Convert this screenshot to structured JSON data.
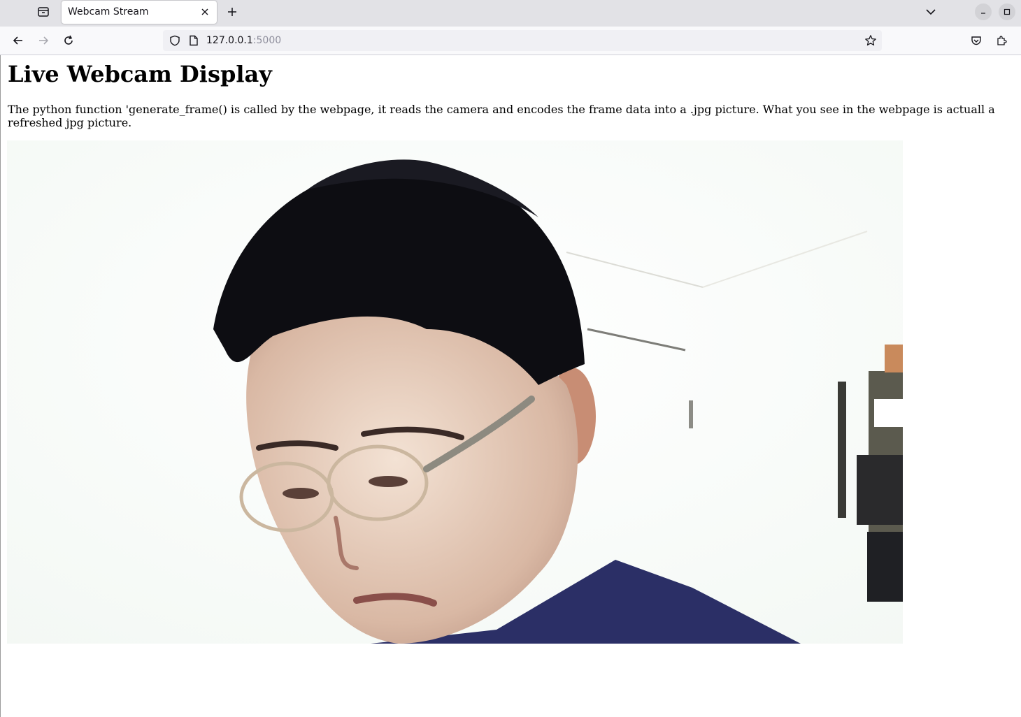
{
  "browser": {
    "tab": {
      "title": "Webcam Stream"
    },
    "address": {
      "host": "127.0.0.1",
      "port": ":5000"
    },
    "icons": {
      "tab_manager": "tab-manager-icon",
      "close": "close-icon",
      "new_tab": "plus-icon",
      "tab_list": "chevron-down-icon",
      "minimize": "minimize-icon",
      "maximize": "maximize-icon",
      "back": "arrow-left-icon",
      "forward": "arrow-right-icon",
      "reload": "reload-icon",
      "shield": "shield-icon",
      "page": "page-icon",
      "bookmark": "star-icon",
      "pocket": "pocket-icon",
      "extensions": "puzzle-icon"
    }
  },
  "page": {
    "heading": "Live Webcam Display",
    "description": "The python function 'generate_frame() is called by the webpage, it reads the camera and encodes the frame data into a .jpg picture. What you see in the webpage is actuall a refreshed jpg picture."
  },
  "colors": {
    "tabstrip_bg": "#e2e2e6",
    "toolbar_bg": "#f9f9fb",
    "urlbar_bg": "#f0f0f4",
    "text": "#15141a",
    "muted_text": "#8f8f9d"
  }
}
